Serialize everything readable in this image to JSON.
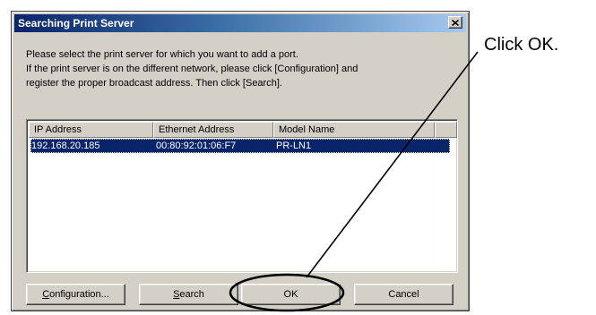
{
  "dialog": {
    "title": "Searching Print Server",
    "close_glyph": "×",
    "instructions": [
      "Please select the print server for which you want to add a port.",
      "If the print server is on the different network, please click [Configuration] and",
      "register the proper broadcast address. Then click [Search]."
    ],
    "list": {
      "columns": [
        "IP Address",
        "Ethernet Address",
        "Model Name"
      ],
      "rows": [
        {
          "ip": "192.168.20.185",
          "ethernet": "00:80:92:01:06:F7",
          "model": "PR-LN1",
          "selected": true
        }
      ]
    },
    "buttons": {
      "configuration": {
        "mnemonic": "C",
        "rest": "onfiguration..."
      },
      "search": {
        "mnemonic": "S",
        "rest": "earch"
      },
      "ok": "OK",
      "cancel": "Cancel"
    }
  },
  "callout": {
    "text": "Click OK."
  },
  "colors": {
    "titlebar_start": "#0a246a",
    "titlebar_end": "#a6caf0",
    "selection": "#0a246a",
    "dialog_face": "#d4d0c8"
  },
  "icons": {
    "close": "close-icon"
  }
}
